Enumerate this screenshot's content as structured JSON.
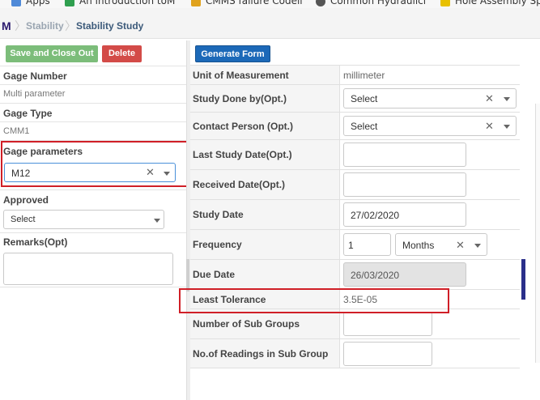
{
  "bookmarks": [
    {
      "label": "Apps",
      "color": "#4f8ad8"
    },
    {
      "label": "An introduction toM",
      "color": "#2f9f4f"
    },
    {
      "label": "CMMS failure Codell",
      "color": "#e0a21c"
    },
    {
      "label": "Common Hydraulici",
      "color": "#555555"
    },
    {
      "label": "Hole Assembly Sp",
      "color": "#e8c000"
    }
  ],
  "breadcrumb": {
    "logo": "M",
    "items": [
      "Stability",
      "Stability Study"
    ]
  },
  "left": {
    "save_button": "Save and Close Out",
    "delete_button": "Delete",
    "gage_number_label": "Gage Number",
    "gage_number_value": "Multi parameter",
    "gage_type_label": "Gage Type",
    "gage_type_value": "CMM1",
    "gage_params_label": "Gage parameters",
    "gage_params_value": "M12",
    "approved_label": "Approved",
    "approved_value": "Select",
    "remarks_label": "Remarks(Opt)",
    "remarks_value": ""
  },
  "form": {
    "generate_button": "Generate Form",
    "unit_label": "Unit of Measurement",
    "unit_value": "millimeter",
    "study_done_label": "Study Done by(Opt.)",
    "study_done_value": "Select",
    "contact_label": "Contact Person (Opt.)",
    "contact_value": "Select",
    "last_study_label": "Last Study Date(Opt.)",
    "last_study_value": "",
    "received_label": "Received Date(Opt.)",
    "received_value": "",
    "study_date_label": "Study Date",
    "study_date_value": "27/02/2020",
    "frequency_label": "Frequency",
    "frequency_value": "1",
    "frequency_unit": "Months",
    "due_date_label": "Due Date",
    "due_date_value": "26/03/2020",
    "least_tol_label": "Least Tolerance",
    "least_tol_value": "3.5E-05",
    "sub_groups_label": "Number of Sub Groups",
    "sub_groups_value": "",
    "readings_label": "No.of Readings in Sub Group",
    "readings_value": ""
  },
  "colors": {
    "highlight": "#d01f27",
    "save": "#7cbd7a",
    "delete": "#d34b48",
    "generate": "#1c69b8"
  }
}
